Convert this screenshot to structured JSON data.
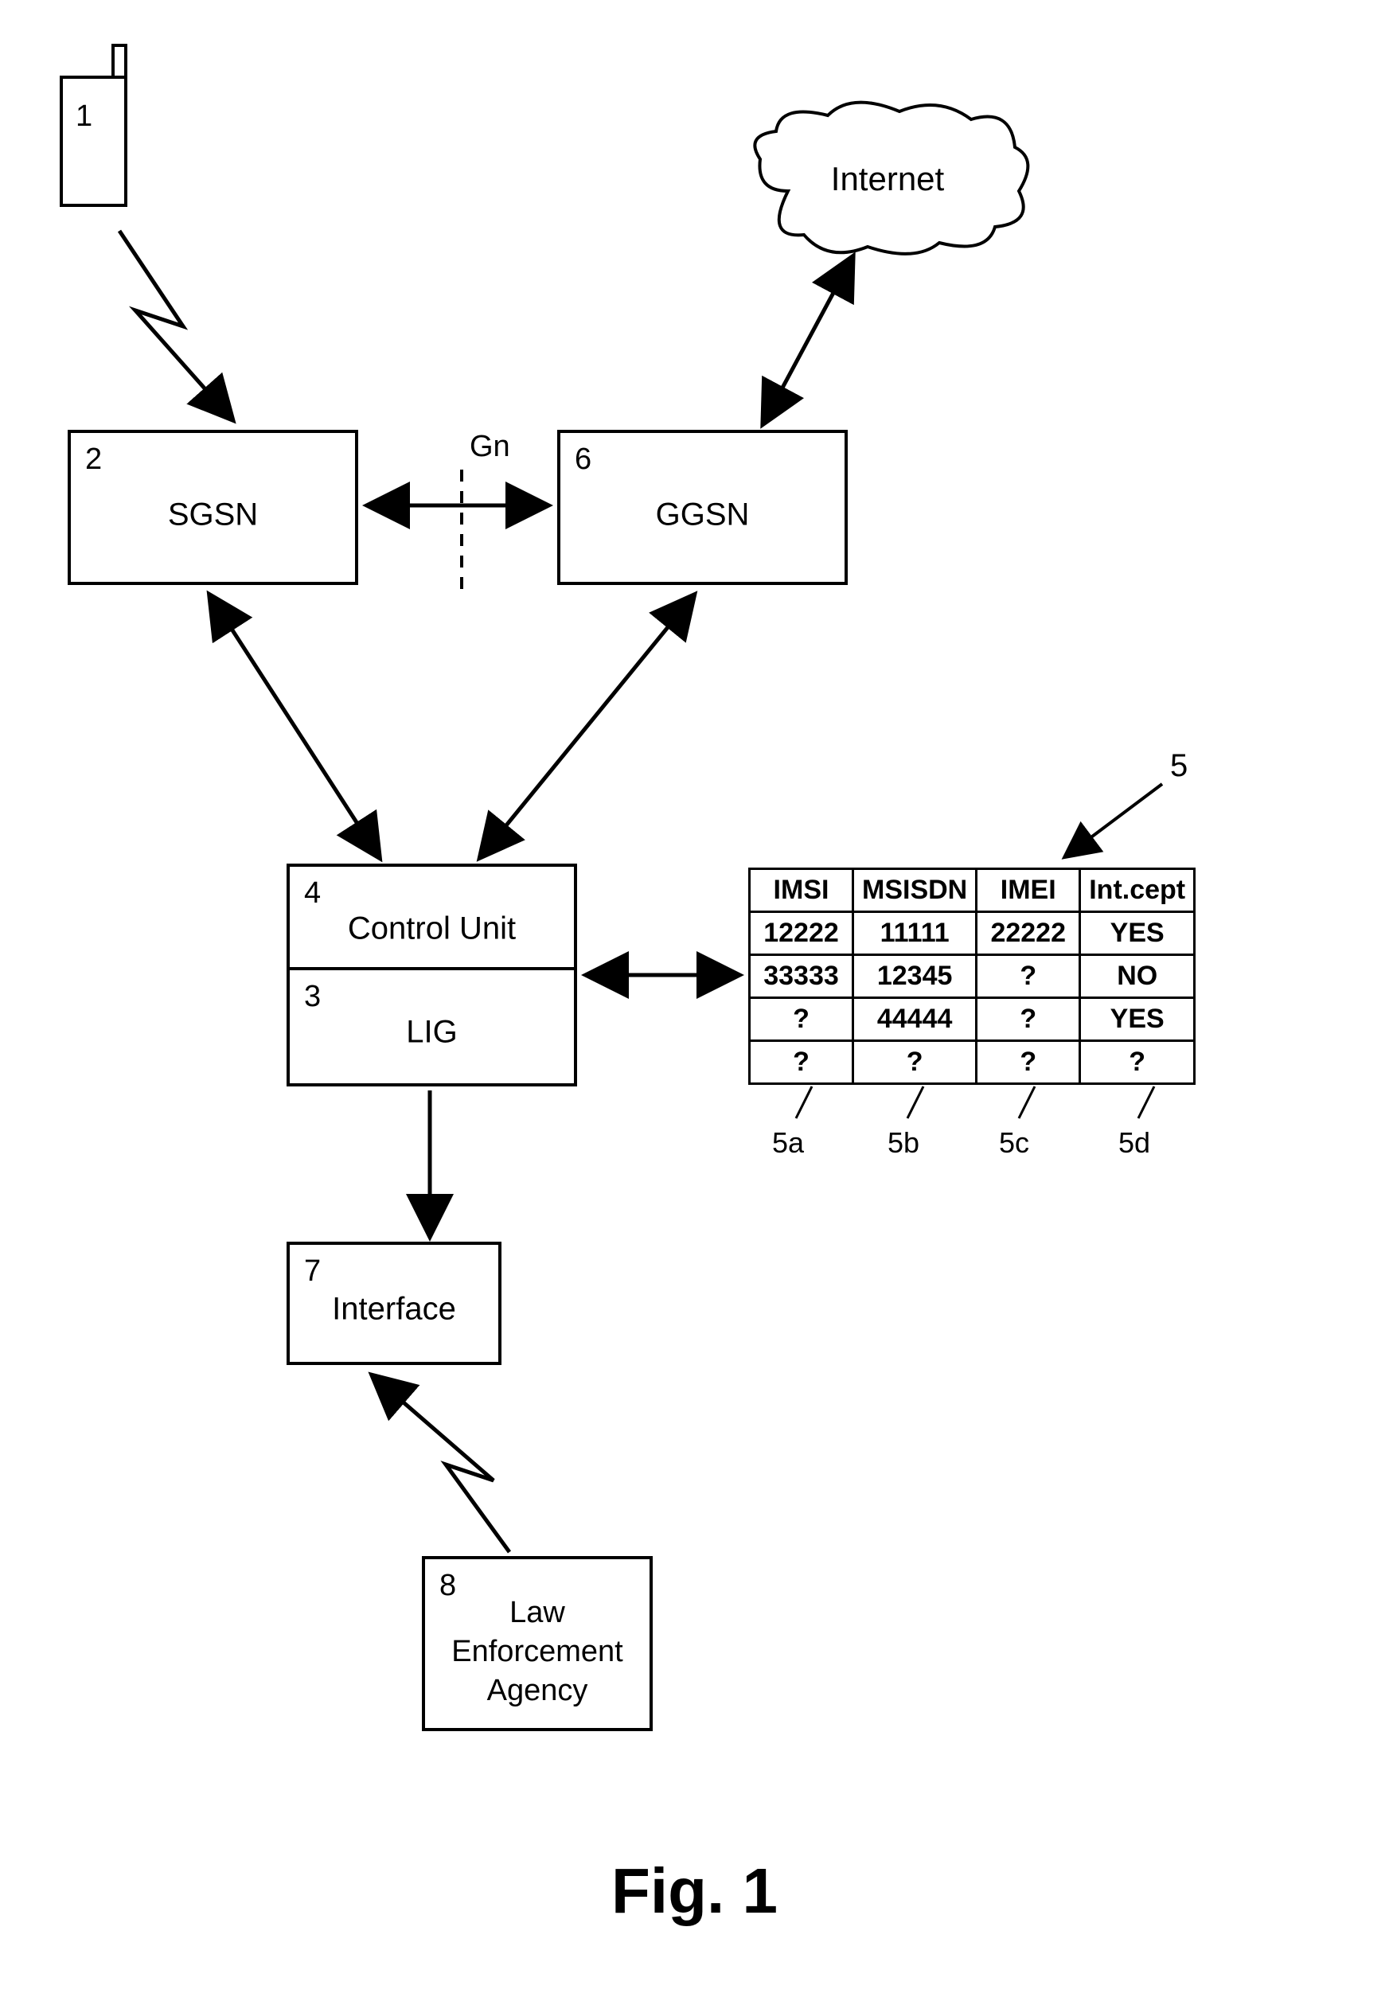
{
  "nodes": {
    "phone": {
      "ref": "1"
    },
    "sgsn": {
      "ref": "2",
      "label": "SGSN"
    },
    "ggsn": {
      "ref": "6",
      "label": "GGSN"
    },
    "control_unit": {
      "ref": "4",
      "label": "Control Unit"
    },
    "lig": {
      "ref": "3",
      "label": "LIG"
    },
    "interface": {
      "ref": "7",
      "label": "Interface"
    },
    "lea": {
      "ref": "8",
      "label": "Law\nEnforcement\nAgency"
    },
    "internet": {
      "label": "Internet"
    },
    "gn": {
      "label": "Gn"
    }
  },
  "table": {
    "ref": "5",
    "headers": [
      "IMSI",
      "MSISDN",
      "IMEI",
      "Int.cept"
    ],
    "rows": [
      [
        "12222",
        "11111",
        "22222",
        "YES"
      ],
      [
        "33333",
        "12345",
        "?",
        "NO"
      ],
      [
        "?",
        "44444",
        "?",
        "YES"
      ],
      [
        "?",
        "?",
        "?",
        "?"
      ]
    ],
    "col_refs": [
      "5a",
      "5b",
      "5c",
      "5d"
    ]
  },
  "caption": "Fig. 1"
}
